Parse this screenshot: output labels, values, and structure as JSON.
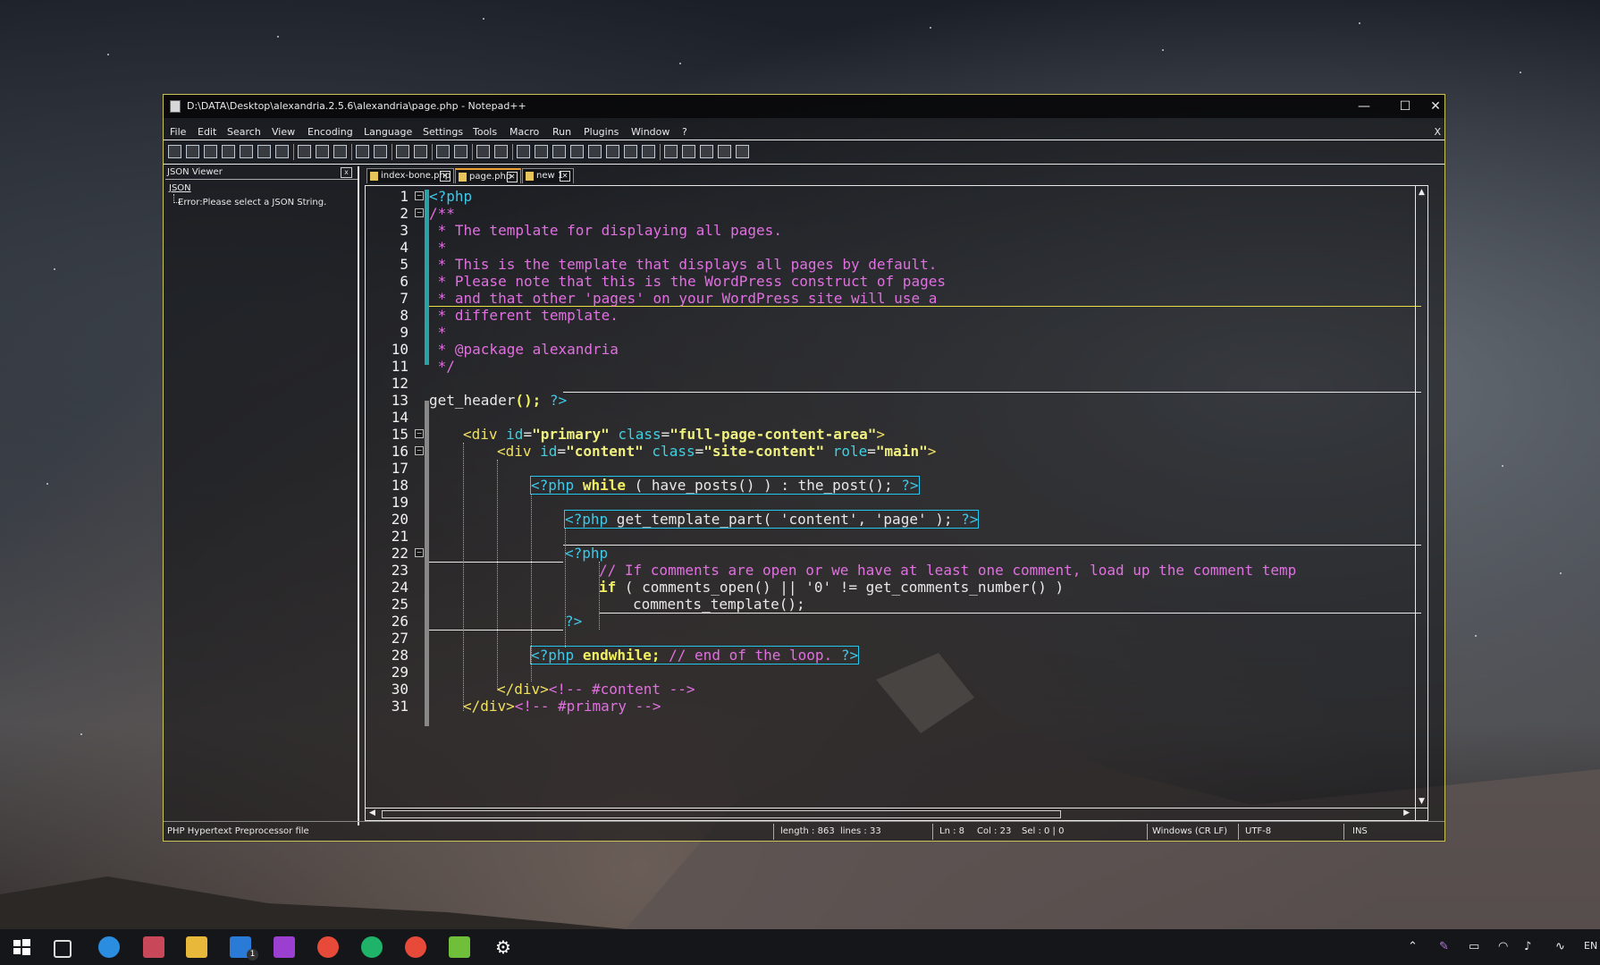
{
  "window": {
    "title": "D:\\DATA\\Desktop\\alexandria.2.5.6\\alexandria\\page.php - Notepad++",
    "minimize": "—",
    "maximize": "☐",
    "close": "✕"
  },
  "menu": {
    "items": [
      "File",
      "Edit",
      "Search",
      "View",
      "Encoding",
      "Language",
      "Settings",
      "Tools",
      "Macro",
      "Run",
      "Plugins",
      "Window",
      "?"
    ],
    "close_x": "X"
  },
  "json_viewer": {
    "title": "JSON Viewer",
    "close": "x",
    "root": "JSON",
    "error": "Error:Please select a JSON String."
  },
  "tabs": [
    {
      "label": "index-bone.php",
      "active": false
    },
    {
      "label": "page.php",
      "active": true
    },
    {
      "label": "new 1",
      "active": false
    }
  ],
  "editor": {
    "line_numbers": [
      "1",
      "2",
      "3",
      "4",
      "5",
      "6",
      "7",
      "8",
      "9",
      "10",
      "11",
      "12",
      "13",
      "14",
      "15",
      "16",
      "17",
      "18",
      "19",
      "20",
      "21",
      "22",
      "23",
      "24",
      "25",
      "26",
      "27",
      "28",
      "29",
      "30",
      "31"
    ],
    "lines": {
      "l1": "<?php",
      "l2": "/**",
      "l3": " * The template for displaying all pages.",
      "l4": " *",
      "l5": " * This is the template that displays all pages by default.",
      "l6": " * Please note that this is the WordPress construct of pages",
      "l7": " * and that other 'pages' on your WordPress site will use a",
      "l8": " * different template.",
      "l9": " *",
      "l10": " * @package alexandria",
      "l11": " */",
      "l13_fn": "get_header",
      "l13_rest": "(); ",
      "l13_close": "?>",
      "l15_open": "<div ",
      "l15_a1": "id",
      "l15_v1": "\"primary\"",
      "l15_a2": "class",
      "l15_v2": "\"full-page-content-area\"",
      "l15_close": ">",
      "l16_open": "<div ",
      "l16_a1": "id",
      "l16_v1": "\"content\"",
      "l16_a2": "class",
      "l16_v2": "\"site-content\"",
      "l16_a3": "role",
      "l16_v3": "\"main\"",
      "l16_close": ">",
      "l18_php": "<?php",
      "l18_kw": "while",
      "l18_rest": " ( have_posts() ) : the_post(); ",
      "l18_close": "?>",
      "l20_php": "<?php",
      "l20_rest": " get_template_part( 'content', 'page' ); ",
      "l20_close": "?>",
      "l22_php": "<?php",
      "l23": "// If comments are open or we have at least one comment, load up the comment temp",
      "l24_kw": "if",
      "l24_rest": " ( comments_open() || '0' != get_comments_number() )",
      "l25": "comments_template();",
      "l26": "?>",
      "l28_php": "<?php",
      "l28_kw": "endwhile;",
      "l28_cm": " // end of the loop. ",
      "l28_close": "?>",
      "l30_tag": "</div>",
      "l30_cm": "<!-- #content -->",
      "l31_tag": "</div>",
      "l31_cm": "<!-- #primary -->"
    }
  },
  "status": {
    "file_type": "PHP Hypertext Preprocessor file",
    "length": "length : 863",
    "lines": "lines : 33",
    "ln": "Ln : 8",
    "col": "Col : 23",
    "sel": "Sel : 0 | 0",
    "eol": "Windows (CR LF)",
    "encoding": "UTF-8",
    "mode": "INS"
  },
  "taskbar": {
    "mail_badge": "1",
    "lang": "EN"
  },
  "colors": {
    "comment": "#e070e0",
    "keyword": "#f0f060",
    "php_tag": "#40c8e8",
    "change_bar": "#27a3a8",
    "window_border": "#c9c35a"
  }
}
